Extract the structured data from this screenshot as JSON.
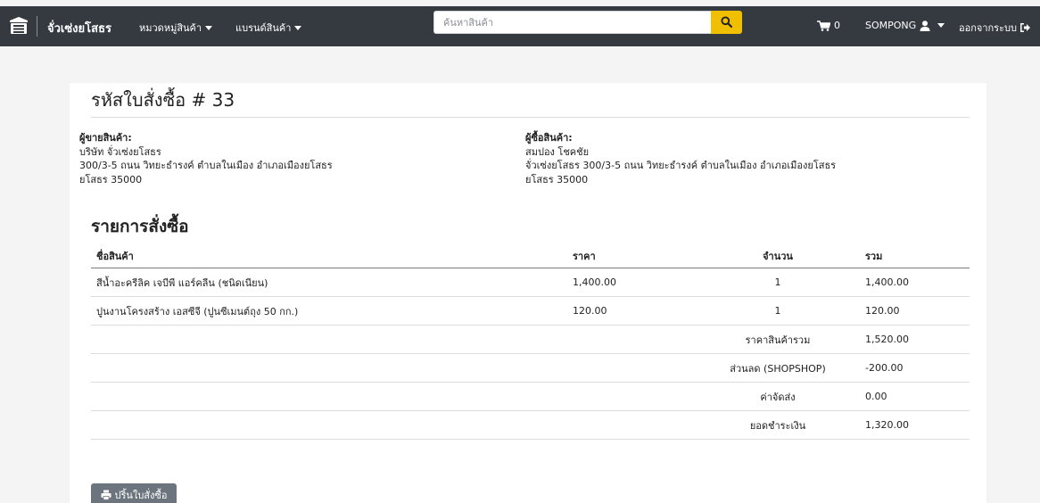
{
  "navbar": {
    "brand_name": "จั่วเซ่งยโสธร",
    "categories_label": "หมวดหมู่สินค้า",
    "brands_label": "แบรนด์สินค้า",
    "search_placeholder": "ค้นหาสินค้า",
    "cart_count": "0",
    "username": "SOMPONG",
    "logout_label": "ออกจากระบบ"
  },
  "order": {
    "title": "รหัสใบสั่งซื้อ # 33",
    "seller": {
      "label": "ผู้ขายสินค้า:",
      "name": "บริษัท จั่วเซ่งยโสธร",
      "address": "300/3-5 ถนน วิทยะธำรงค์ ตำบลในเมือง อำเภอเมืองยโสธร",
      "province": "ยโสธร 35000"
    },
    "buyer": {
      "label": "ผู้ซื้อสินค้า:",
      "name": "สมปอง โชคชัย",
      "address": "จั่วเซ่งยโสธร 300/3-5 ถนน วิทยะธำรงค์ ตำบลในเมือง อำเภอเมืองยโสธร",
      "province": "ยโสธร 35000"
    },
    "items_heading": "รายการสั่งซื้อ",
    "columns": {
      "name": "ชื่อสินค้า",
      "price": "ราคา",
      "qty": "จำนวน",
      "total": "รวม"
    },
    "items": [
      {
        "name": "สีน้ำอะครีลิค เจบีพี แอร์คลีน (ชนิดเนียน)",
        "price": "1,400.00",
        "qty": "1",
        "total": "1,400.00"
      },
      {
        "name": "ปูนงานโครงสร้าง เอสซีจี (ปูนซีเมนต์ถุง 50 กก.)",
        "price": "120.00",
        "qty": "1",
        "total": "120.00"
      }
    ],
    "summary": [
      {
        "label": "ราคาสินค้ารวม",
        "value": "1,520.00"
      },
      {
        "label": "ส่วนลด (SHOPSHOP)",
        "value": "-200.00"
      },
      {
        "label": "ค่าจัดส่ง",
        "value": "0.00"
      },
      {
        "label": "ยอดชำระเงิน",
        "value": "1,320.00"
      }
    ],
    "print_label": "ปริ้นใบสั่งซื้อ"
  }
}
